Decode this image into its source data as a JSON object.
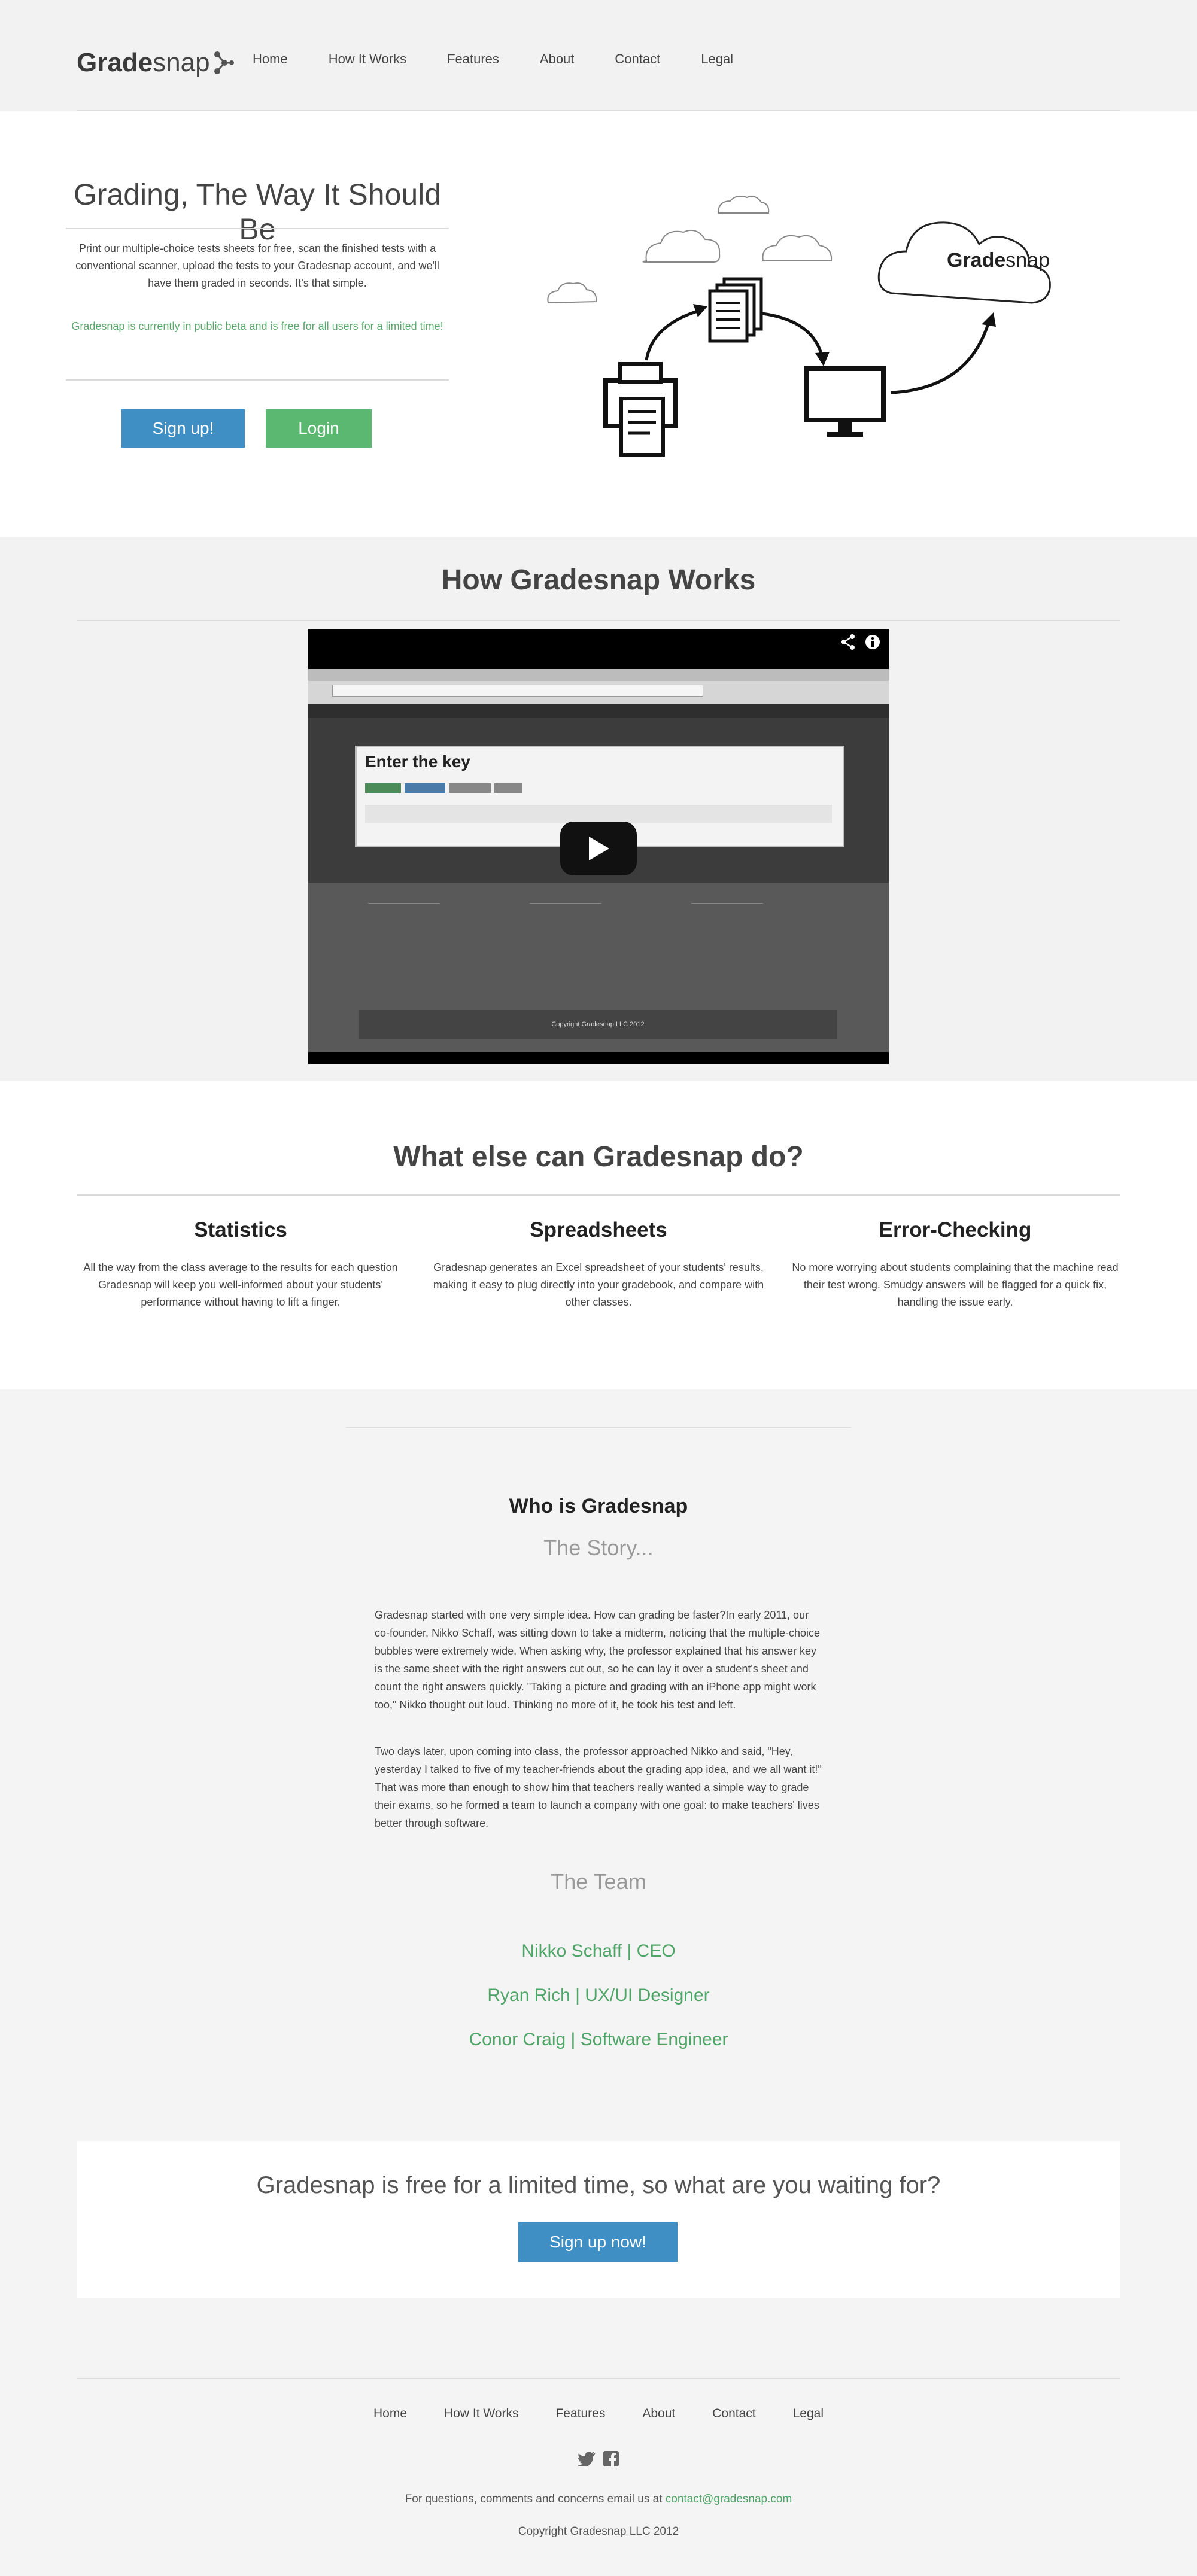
{
  "nav": {
    "logo_bold": "Grade",
    "logo_light": "snap",
    "links": [
      "Home",
      "How It Works",
      "Features",
      "About",
      "Contact",
      "Legal"
    ]
  },
  "hero": {
    "title": "Grading, The Way It Should Be",
    "text": "Print our multiple-choice tests sheets for free, scan the finished tests with a conventional scanner, upload the tests to your Gradesnap account, and we'll have them graded in seconds. It's that simple.",
    "beta": "Gradesnap is currently in public beta and is free for all users for a limited time!",
    "signup_label": "Sign up!",
    "login_label": "Login",
    "cloud_logo_bold": "Grade",
    "cloud_logo_light": "snap"
  },
  "how": {
    "title": "How Gradesnap Works",
    "video_panel_title": "Enter the key",
    "video_copyright": "Copyright Gradesnap LLC 2012"
  },
  "features": {
    "title": "What else can Gradesnap do?",
    "items": [
      {
        "title": "Statistics",
        "text": "All the way from the class average to the results for each question Gradesnap will keep you well-informed about your students' performance without having to lift a finger."
      },
      {
        "title": "Spreadsheets",
        "text": "Gradesnap generates an Excel spreadsheet of your students' results, making it easy to plug directly into your gradebook, and compare with other classes."
      },
      {
        "title": "Error-Checking",
        "text": "No more worrying about students complaining that the machine read their test wrong. Smudgy answers will be flagged for a quick fix, handling the issue early."
      }
    ]
  },
  "about": {
    "title_prefix": "Who is ",
    "title_bold": "Grade",
    "title_light": "snap",
    "story_heading": "The Story...",
    "story_p1": "Gradesnap started with one very simple idea. How can grading be faster?In early 2011, our co-founder, Nikko Schaff, was sitting down to take a midterm, noticing that the multiple-choice bubbles were extremely wide. When asking why, the professor explained that his answer key is the same sheet with the right answers cut out, so he can lay it over a student's sheet and count the right answers quickly. \"Taking a picture and grading with an iPhone app might work too,\" Nikko thought out loud. Thinking no more of it, he took his test and left.",
    "story_p2": "Two days later, upon coming into class, the professor approached Nikko and said, \"Hey, yesterday I talked to five of my teacher-friends about the grading app idea, and we all want it!\" That was more than enough to show him that teachers really wanted a simple way to grade their exams, so he formed a team to launch a company with one goal: to make teachers' lives better through software.",
    "team_heading": "The Team",
    "team": [
      "Nikko Schaff | CEO",
      "Ryan Rich | UX/UI Designer",
      "Conor Craig | Software Engineer"
    ]
  },
  "cta": {
    "text": "Gradesnap is free for a limited time, so what are you waiting for?",
    "button": "Sign up now!"
  },
  "footer": {
    "links": [
      "Home",
      "How It Works",
      "Features",
      "About",
      "Contact",
      "Legal"
    ],
    "contact_prefix": "For questions, comments and concerns email us at ",
    "email": "contact@gradesnap.com",
    "copyright": "Copyright Gradesnap LLC 2012"
  },
  "colors": {
    "accent_blue": "#3f8ec4",
    "accent_green": "#5bb870",
    "text_green": "#4ea567"
  },
  "icons": [
    "printer-icon",
    "documents-icon",
    "monitor-icon",
    "cloud-icon",
    "play-icon",
    "share-icon",
    "info-icon",
    "twitter-icon",
    "facebook-icon"
  ]
}
